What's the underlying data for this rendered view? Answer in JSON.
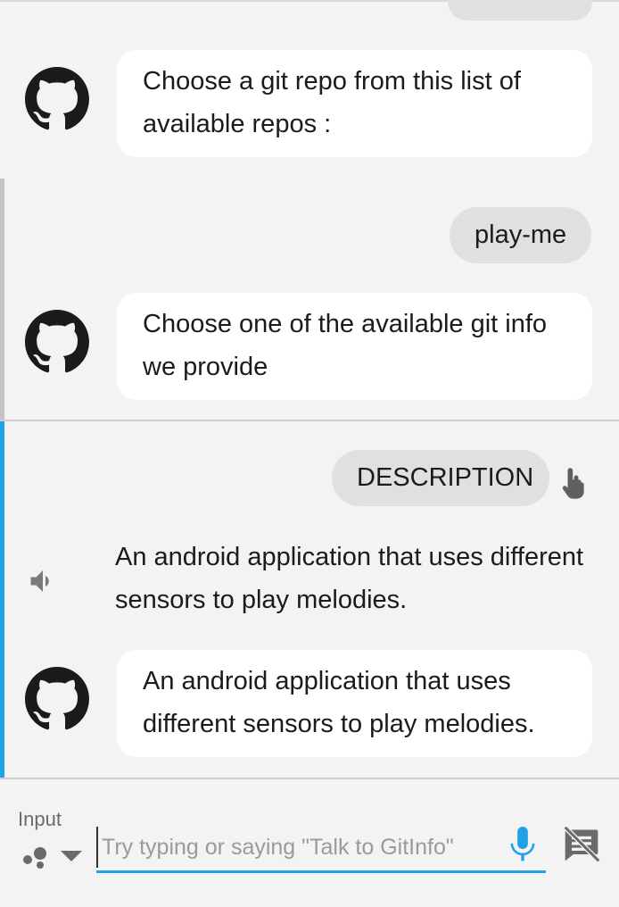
{
  "messages": {
    "bot_1": "Choose a git repo from this list of available repos :",
    "user_1": "play-me",
    "bot_2": "Choose one of the available git info we provide",
    "user_2": "DESCRIPTION",
    "speech": "An android application that uses different sensors to play melodies.",
    "bot_3": "An android application that uses different sensors to play melodies."
  },
  "input": {
    "label": "Input",
    "placeholder": "Try typing or saying \"Talk to GitInfo\"",
    "value": ""
  },
  "icons": {
    "avatar": "github-icon",
    "speaker": "speaker-icon",
    "touch": "touch-icon",
    "mode": "input-mode-icon",
    "mic": "mic-icon",
    "display_off": "no-display-icon"
  },
  "colors": {
    "accent": "#1ea1e6",
    "mic": "#1ea1e6",
    "background": "#f3f3f3",
    "bot_bubble": "#ffffff",
    "user_bubble": "#e0e0e0",
    "rail_old": "#c4c4c4",
    "rail_active": "#1ea1e6"
  }
}
